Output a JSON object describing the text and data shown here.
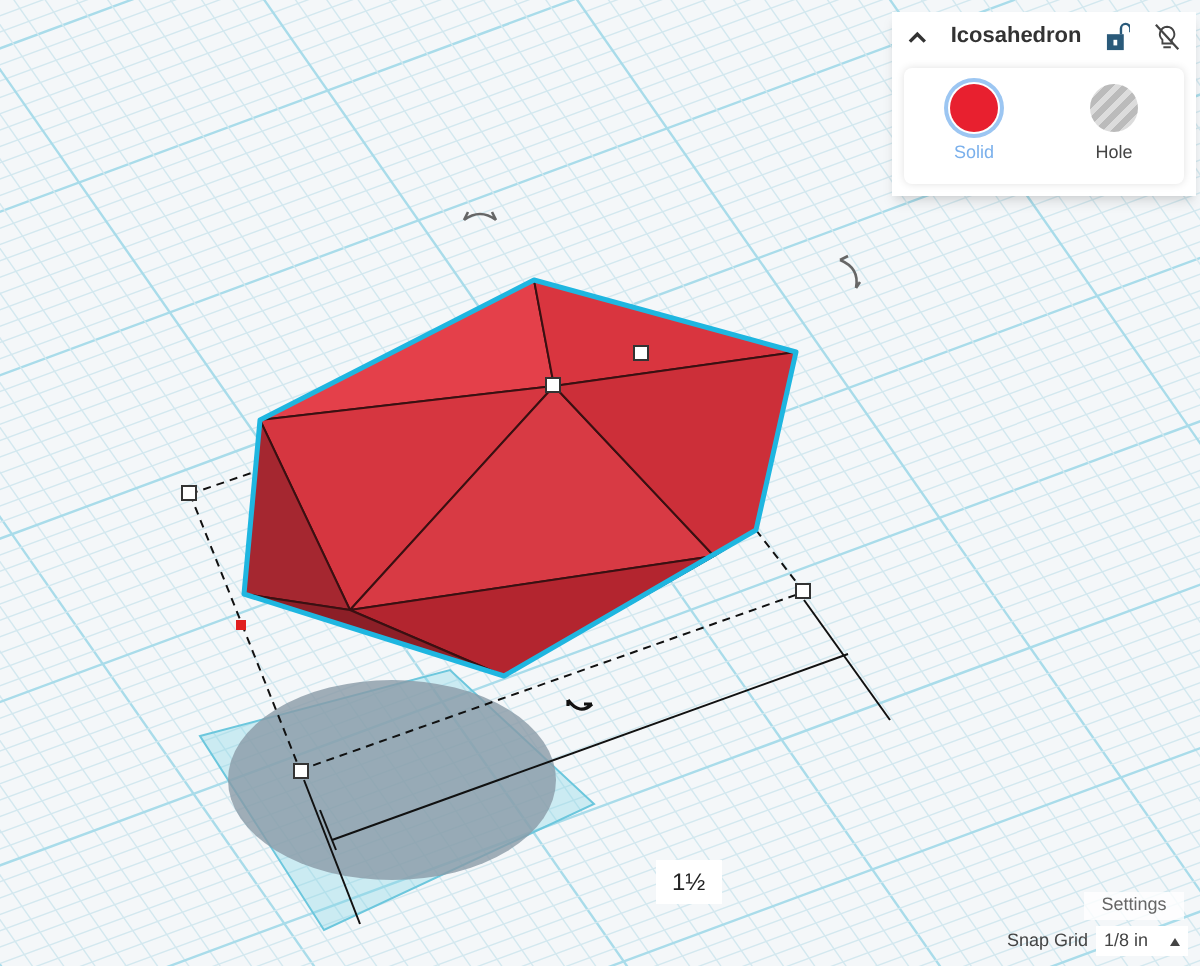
{
  "shape_panel": {
    "title": "Icosahedron",
    "options": [
      {
        "label": "Solid",
        "kind": "solid",
        "selected": true
      },
      {
        "label": "Hole",
        "kind": "hole",
        "selected": false
      }
    ]
  },
  "dimension_label": "1½",
  "settings_button": "Settings",
  "snap_grid": {
    "label": "Snap Grid",
    "value": "1/8 in"
  }
}
